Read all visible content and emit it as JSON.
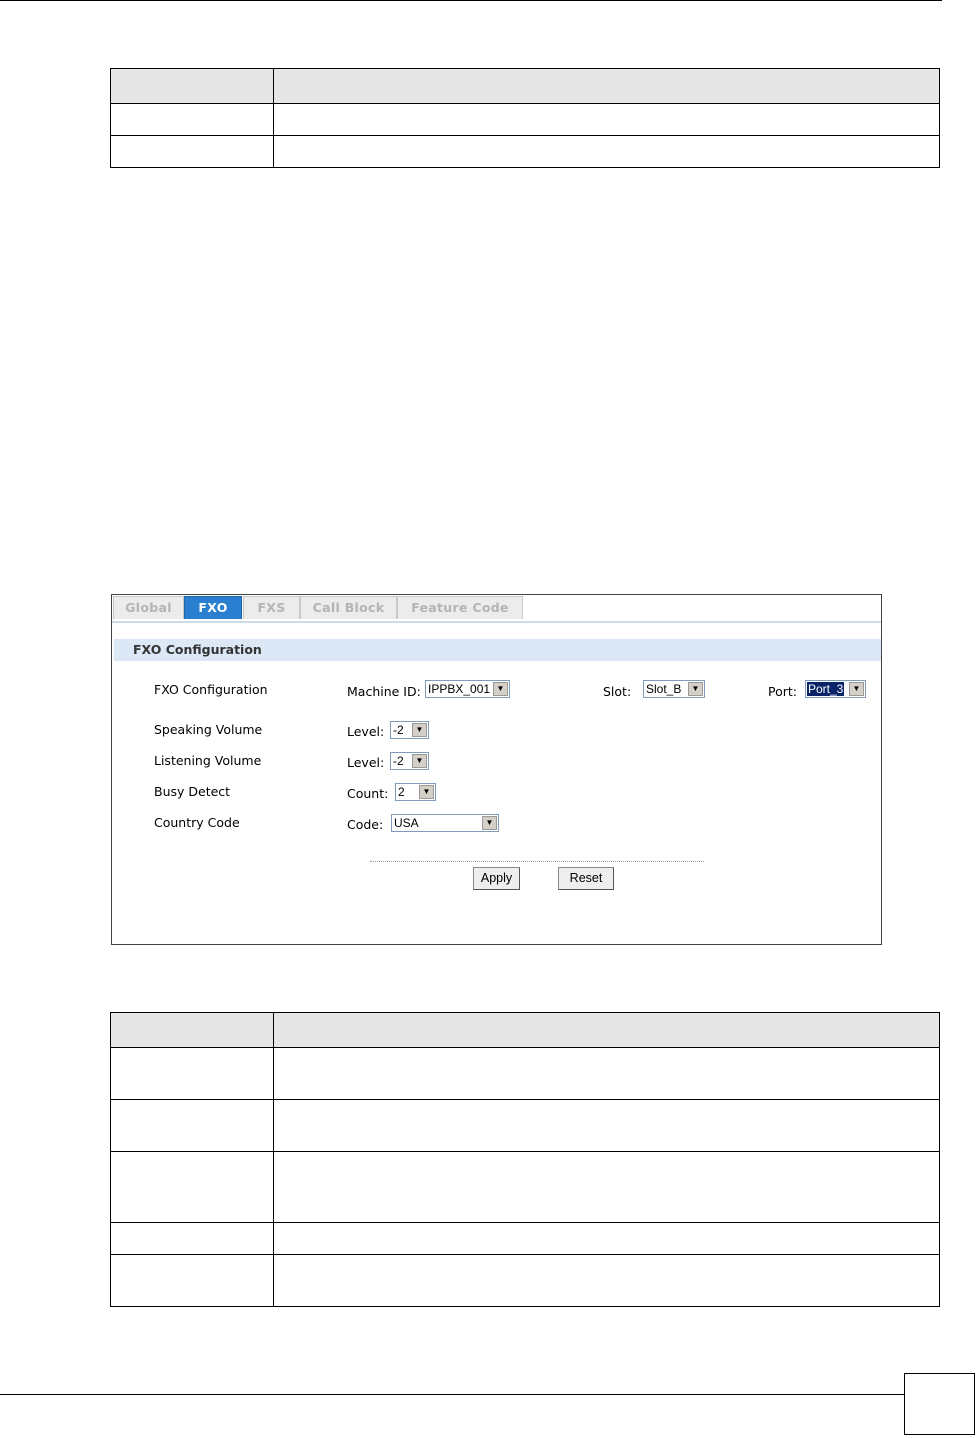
{
  "tabs": [
    {
      "label": "Global",
      "active": false
    },
    {
      "label": "FXO",
      "active": true
    },
    {
      "label": "FXS",
      "active": false
    },
    {
      "label": "Call Block",
      "active": false
    },
    {
      "label": "Feature Code",
      "active": false
    }
  ],
  "section_title": "FXO Configuration",
  "rows": {
    "fxo_configuration": "FXO Configuration",
    "speaking_volume": "Speaking Volume",
    "listening_volume": "Listening Volume",
    "busy_detect": "Busy Detect",
    "country_code": "Country Code"
  },
  "fields": {
    "machine_id_label": "Machine ID:",
    "machine_id_value": "IPPBX_001",
    "slot_label": "Slot:",
    "slot_value": "Slot_B",
    "port_label": "Port:",
    "port_value": "Port_3",
    "speaking_level_label": "Level:",
    "speaking_level_value": "-2",
    "listening_level_label": "Level:",
    "listening_level_value": "-2",
    "busy_count_label": "Count:",
    "busy_count_value": "2",
    "country_code_label": "Code:",
    "country_code_value": "USA"
  },
  "buttons": {
    "apply": "Apply",
    "reset": "Reset"
  }
}
